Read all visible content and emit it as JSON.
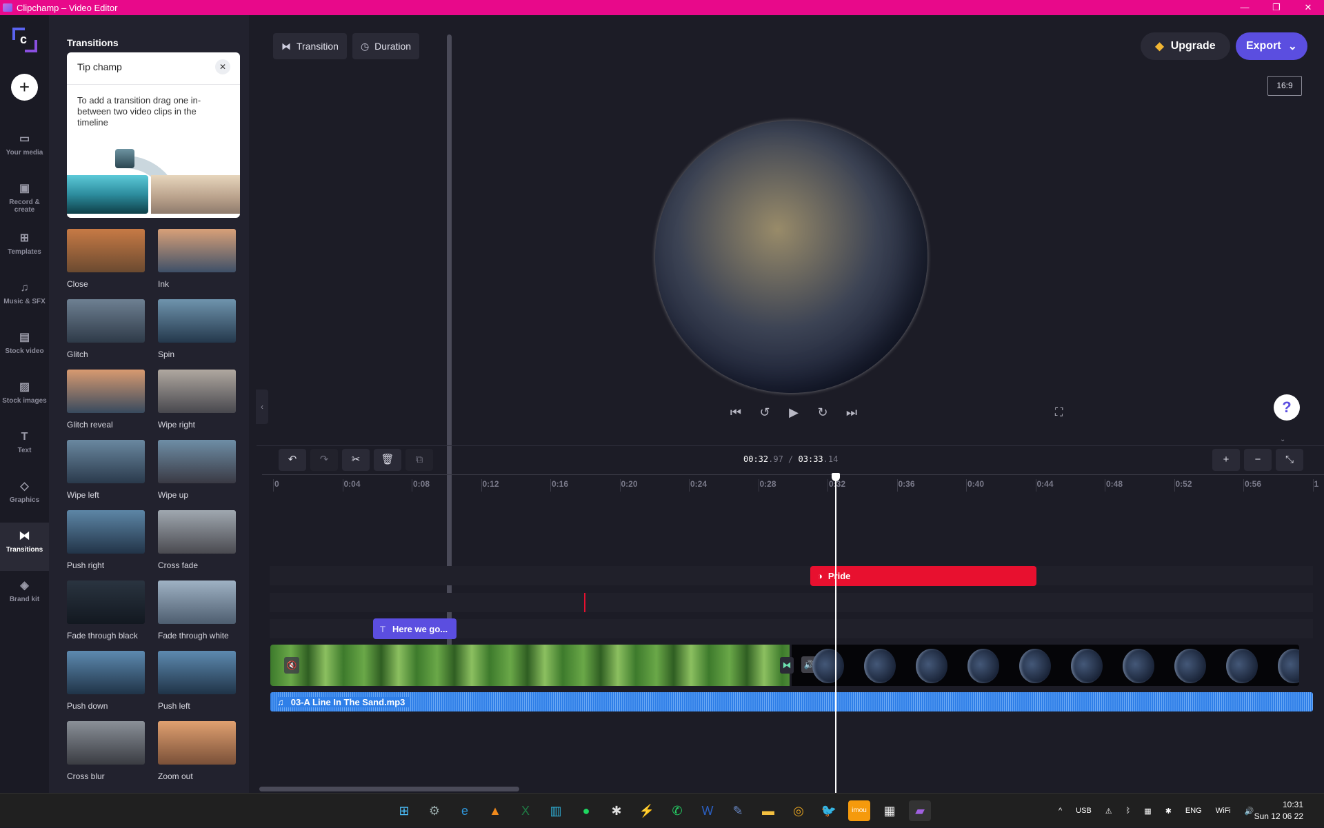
{
  "window": {
    "title": "Clipchamp – Video Editor",
    "controls": [
      "—",
      "❐",
      "✕"
    ]
  },
  "rail": {
    "add_label": "+",
    "items": [
      {
        "label": "Your media",
        "icon": "▭"
      },
      {
        "label": "Record & create",
        "icon": "▣"
      },
      {
        "label": "Templates",
        "icon": "⊞"
      },
      {
        "label": "Music & SFX",
        "icon": "♫"
      },
      {
        "label": "Stock video",
        "icon": "▤"
      },
      {
        "label": "Stock images",
        "icon": "▨"
      },
      {
        "label": "Text",
        "icon": "T"
      },
      {
        "label": "Graphics",
        "icon": "◇"
      },
      {
        "label": "Transitions",
        "icon": "⧓",
        "active": true
      },
      {
        "label": "Brand kit",
        "icon": "◈"
      }
    ]
  },
  "panel": {
    "title": "Transitions",
    "tip": {
      "title": "Tip champ",
      "body": "To add a transition drag one in-between two video clips in the timeline",
      "close": "✕"
    },
    "transitions": [
      {
        "label": "Close",
        "c1": "#c77a45",
        "c2": "#6b4a30"
      },
      {
        "label": "Ink",
        "c1": "#d8a078",
        "c2": "#3e5068"
      },
      {
        "label": "Glitch",
        "c1": "#6e8092",
        "c2": "#2e3a48"
      },
      {
        "label": "Spin",
        "c1": "#6f94ad",
        "c2": "#24384c"
      },
      {
        "label": "Glitch reveal",
        "c1": "#d89a70",
        "c2": "#384a5e"
      },
      {
        "label": "Wipe right",
        "c1": "#b0a8a0",
        "c2": "#48484e"
      },
      {
        "label": "Wipe left",
        "c1": "#6a88a0",
        "c2": "#2a3a4c"
      },
      {
        "label": "Wipe up",
        "c1": "#6e8ea6",
        "c2": "#3a3a44"
      },
      {
        "label": "Push right",
        "c1": "#5d86a6",
        "c2": "#223448"
      },
      {
        "label": "Cross fade",
        "c1": "#a0a8b0",
        "c2": "#4a4a50"
      },
      {
        "label": "Fade through black",
        "c1": "#2a3440",
        "c2": "#121820"
      },
      {
        "label": "Fade through white",
        "c1": "#9fb2c4",
        "c2": "#4e5e70"
      },
      {
        "label": "Push down",
        "c1": "#5d8ab0",
        "c2": "#203448"
      },
      {
        "label": "Push left",
        "c1": "#5d8ab0",
        "c2": "#203448"
      },
      {
        "label": "Cross blur",
        "c1": "#8a9098",
        "c2": "#3a3c42"
      },
      {
        "label": "Zoom out",
        "c1": "#e0a070",
        "c2": "#7a5038"
      }
    ]
  },
  "toolbar": {
    "transition_label": "Transition",
    "transition_icon": "⧓",
    "duration_label": "Duration",
    "duration_icon": "◷",
    "upgrade_label": "Upgrade",
    "upgrade_icon": "◆",
    "export_label": "Export",
    "export_icon": "⌄",
    "aspect_ratio": "16:9"
  },
  "preview": {
    "flag_colors": [
      "#b00000",
      "#b06010",
      "#b0a020",
      "#106010",
      "#1020b0",
      "#501060"
    ]
  },
  "player": {
    "skip_start": "⏮",
    "rewind5": "↺",
    "play": "▶",
    "forward5": "↻",
    "skip_end": "⏭",
    "fullscreen": "⛶",
    "help": "?",
    "collapse": "⌄"
  },
  "timeline": {
    "tools": [
      {
        "name": "undo",
        "icon": "↶"
      },
      {
        "name": "redo",
        "icon": "↷",
        "dim": true
      },
      {
        "name": "split",
        "icon": "✂"
      },
      {
        "name": "delete",
        "icon": "🗑"
      },
      {
        "name": "add-media",
        "icon": "⧉",
        "dim": true
      }
    ],
    "current_time": "00:32",
    "current_frac": ".97",
    "sep": "/",
    "total_time": "03:33",
    "total_frac": ".14",
    "zoom_in": "+",
    "zoom_out": "−",
    "fit": "⤡",
    "ruler": [
      "0",
      "0:04",
      "0:08",
      "0:12",
      "0:16",
      "0:20",
      "0:24",
      "0:28",
      "0:32",
      "0:36",
      "0:40",
      "0:44",
      "0:48",
      "0:52",
      "0:56",
      "1"
    ],
    "clips": {
      "filter": {
        "label": "Pride",
        "icon": "◑"
      },
      "text": {
        "label": "Here we go...",
        "icon": "T"
      },
      "audio": {
        "label": "03-A Line In The Sand.mp3",
        "icon": "♫"
      },
      "video_mute_icon": "🔇",
      "video_speaker_icon": "🔊",
      "transition_icon": "⧓"
    }
  },
  "taskbar": {
    "apps": [
      {
        "name": "start",
        "icon": "⊞",
        "color": "#4cc2ff"
      },
      {
        "name": "settings",
        "icon": "⚙",
        "color": "#9aa"
      },
      {
        "name": "edge",
        "icon": "e",
        "color": "#2f9ae0"
      },
      {
        "name": "vlc",
        "icon": "▲",
        "color": "#f08a1c"
      },
      {
        "name": "excel",
        "icon": "X",
        "color": "#1f7a44"
      },
      {
        "name": "app-blue",
        "icon": "▥",
        "color": "#2fb0d8"
      },
      {
        "name": "spotify",
        "icon": "●",
        "color": "#1ed760"
      },
      {
        "name": "slack",
        "icon": "✱",
        "color": "#e0e0e0"
      },
      {
        "name": "messenger",
        "icon": "⚡",
        "color": "#a05cf0"
      },
      {
        "name": "whatsapp",
        "icon": "✆",
        "color": "#25d366"
      },
      {
        "name": "word",
        "icon": "W",
        "color": "#2b5fc0"
      },
      {
        "name": "paint",
        "icon": "✎",
        "color": "#6a8ac8"
      },
      {
        "name": "explorer",
        "icon": "▬",
        "color": "#f4c040"
      },
      {
        "name": "chrome",
        "icon": "◎",
        "color": "#e0a020"
      },
      {
        "name": "twitter",
        "icon": "🐦",
        "color": "#1d9bf0"
      },
      {
        "name": "imou",
        "icon": "imou",
        "color": "#f59a0c"
      },
      {
        "name": "store",
        "icon": "▦",
        "color": "#eee"
      },
      {
        "name": "clipchamp",
        "icon": "▰",
        "color": "#a060e0"
      }
    ],
    "tray": [
      "^",
      "USB",
      "⚠",
      "ᛒ",
      "▦",
      "✱",
      "ENG",
      "WiFi",
      "🔊"
    ],
    "time": "10:31",
    "date": "Sun 12 06 22"
  }
}
